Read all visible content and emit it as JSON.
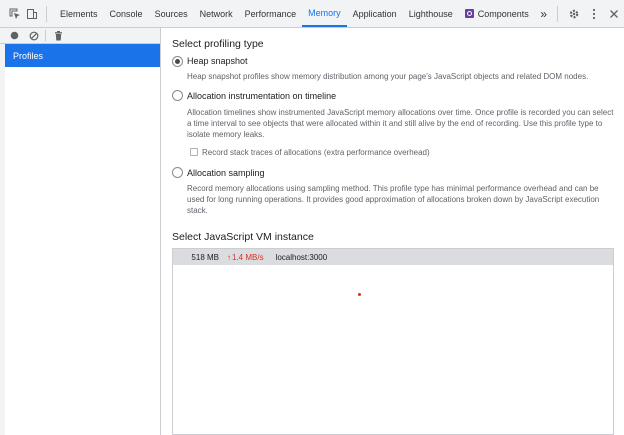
{
  "toolbar": {
    "tabs": [
      {
        "label": "Elements"
      },
      {
        "label": "Console"
      },
      {
        "label": "Sources"
      },
      {
        "label": "Network"
      },
      {
        "label": "Performance"
      },
      {
        "label": "Memory",
        "active": true
      },
      {
        "label": "Application"
      },
      {
        "label": "Lighthouse"
      },
      {
        "label": "Components",
        "icon": "react-components-icon"
      }
    ],
    "more_label": "»",
    "accent_color": "#1a73e8"
  },
  "sidebar": {
    "profiles_label": "Profiles",
    "selected_color": "#1a73e8"
  },
  "main": {
    "profiling_type_heading": "Select profiling type",
    "options": [
      {
        "title": "Heap snapshot",
        "checked": true,
        "description": "Heap snapshot profiles show memory distribution among your page's JavaScript objects and related DOM nodes."
      },
      {
        "title": "Allocation instrumentation on timeline",
        "checked": false,
        "description": "Allocation timelines show instrumented JavaScript memory allocations over time. Once profile is recorded you can select a time interval to see objects that were allocated within it and still alive by the end of recording. Use this profile type to isolate memory leaks.",
        "checkbox_label": "Record stack traces of allocations (extra performance overhead)",
        "checkbox_checked": false
      },
      {
        "title": "Allocation sampling",
        "checked": false,
        "description": "Record memory allocations using sampling method. This profile type has minimal performance overhead and can be used for long running operations. It provides good approximation of allocations broken down by JavaScript execution stack."
      }
    ],
    "vm_heading": "Select JavaScript VM instance",
    "vm_instances": [
      {
        "size": "518 MB",
        "rate": "1.4 MB/s",
        "url": "localhost:3000"
      }
    ]
  }
}
